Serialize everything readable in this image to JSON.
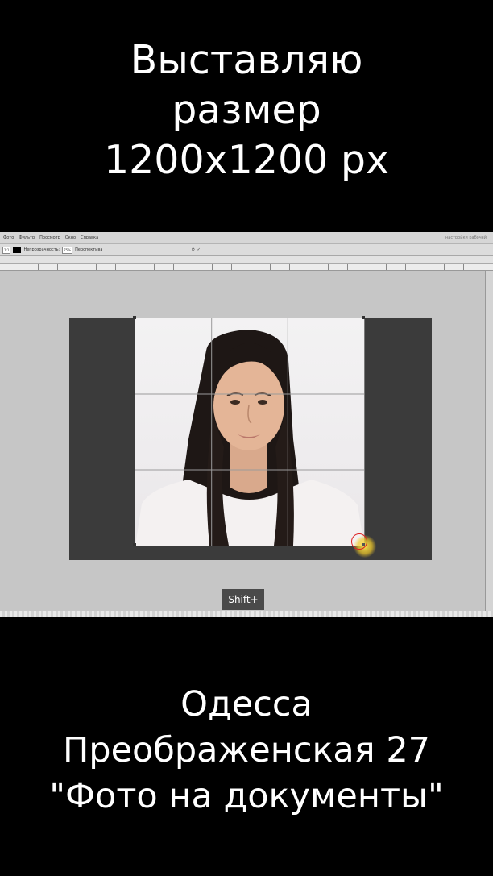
{
  "top_caption": {
    "line1": "Выставляю",
    "line2": "размер",
    "line3": "1200x1200 px"
  },
  "photoshop": {
    "menu": {
      "items": [
        "Фото",
        "Фильтр",
        "Просмотр",
        "Окно",
        "Справка"
      ],
      "right_label": "настройки рабочей"
    },
    "options": {
      "zoom_value": "1:1",
      "opacity_label": "Непрозрачность:",
      "opacity_value": "75%",
      "perspective_label": "Перспектива"
    },
    "shift_badge": "Shift+"
  },
  "bottom_caption": {
    "line1": "Одесса",
    "line2": "Преображенская 27",
    "line3": "\"Фото на документы\""
  },
  "colors": {
    "background": "#000000",
    "caption_text": "#ffffff",
    "canvas_dark": "#3b3b3b",
    "workspace": "#c6c6c6",
    "badge": "#4a4a4a"
  }
}
